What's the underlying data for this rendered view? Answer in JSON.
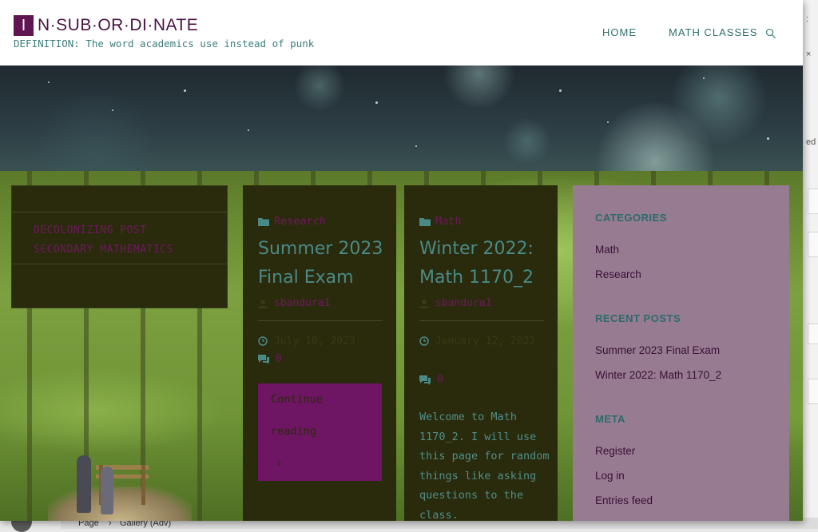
{
  "site": {
    "logo_mark": "I",
    "logo_text": "N·SUB·OR·DI·NATE",
    "tagline": "DEFINITION: The word academics use instead of punk"
  },
  "nav": {
    "items": [
      {
        "label": "HOME"
      },
      {
        "label": "MATH CLASSES"
      }
    ],
    "search_icon": "search-icon"
  },
  "featured": {
    "link": "DECOLONIZING POST SECONDARY MATHEMATICS"
  },
  "posts": [
    {
      "category": "Research",
      "title": "Summer 2023 Final Exam",
      "author": "sbandura1",
      "date": "July 10, 2023",
      "comments": "0",
      "continue_line1": "Continue",
      "continue_line2": "reading",
      "continue_arrow": "›"
    },
    {
      "category": "Math",
      "title": "Winter 2022: Math 1170_2",
      "author": "sbandura1",
      "date": "January 12, 2022",
      "comments": "0",
      "excerpt": "Welcome to Math 1170_2. I will use this page for random things like asking questions to the class."
    }
  ],
  "sidebar": {
    "categories_title": "CATEGORIES",
    "categories": [
      "Math",
      "Research"
    ],
    "recent_title": "RECENT POSTS",
    "recent": [
      "Summer 2023 Final Exam",
      "Winter 2022: Math 1170_2"
    ],
    "meta_title": "META",
    "meta": [
      "Register",
      "Log in",
      "Entries feed"
    ]
  },
  "background": {
    "right_edge_text": "ed",
    "bottom_items": [
      "Page",
      "›",
      "Gallery (Adv)"
    ]
  },
  "colors": {
    "accent_purple": "#6e1563",
    "teal": "#2e6b6b",
    "card_bg": "#2a2a0c",
    "sidebar_bg": "#967b91"
  }
}
